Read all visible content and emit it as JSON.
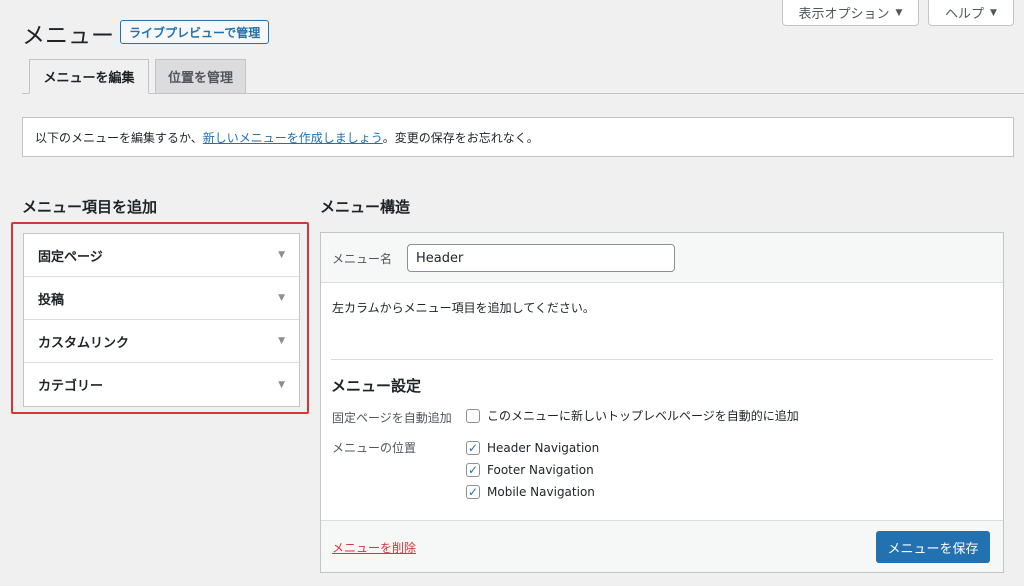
{
  "header": {
    "title": "メニュー",
    "live_preview_label": "ライブプレビューで管理",
    "screen_options_label": "表示オプション",
    "help_label": "ヘルプ"
  },
  "tabs": [
    {
      "label": "メニューを編集",
      "active": true
    },
    {
      "label": "位置を管理",
      "active": false
    }
  ],
  "notice": {
    "text_before": "以下のメニューを編集するか、",
    "link_text": "新しいメニューを作成しましょう",
    "text_after": "。変更の保存をお忘れなく。"
  },
  "add_items": {
    "heading": "メニュー項目を追加",
    "items": [
      {
        "label": "固定ページ"
      },
      {
        "label": "投稿"
      },
      {
        "label": "カスタムリンク"
      },
      {
        "label": "カテゴリー"
      }
    ]
  },
  "structure": {
    "heading": "メニュー構造",
    "menu_name_label": "メニュー名",
    "menu_name_value": "Header",
    "empty_hint": "左カラムからメニュー項目を追加してください。"
  },
  "settings": {
    "heading": "メニュー設定",
    "auto_add_label": "固定ページを自動追加",
    "auto_add_option": "このメニューに新しいトップレベルページを自動的に追加",
    "auto_add_checked": false,
    "location_label": "メニューの位置",
    "locations": [
      {
        "label": "Header Navigation",
        "checked": true
      },
      {
        "label": "Footer Navigation",
        "checked": true
      },
      {
        "label": "Mobile Navigation",
        "checked": true
      }
    ]
  },
  "footer": {
    "delete_label": "メニューを削除",
    "save_label": "メニューを保存"
  },
  "colors": {
    "accent": "#2271b1",
    "danger": "#d63638",
    "highlight_frame": "#e02424"
  }
}
